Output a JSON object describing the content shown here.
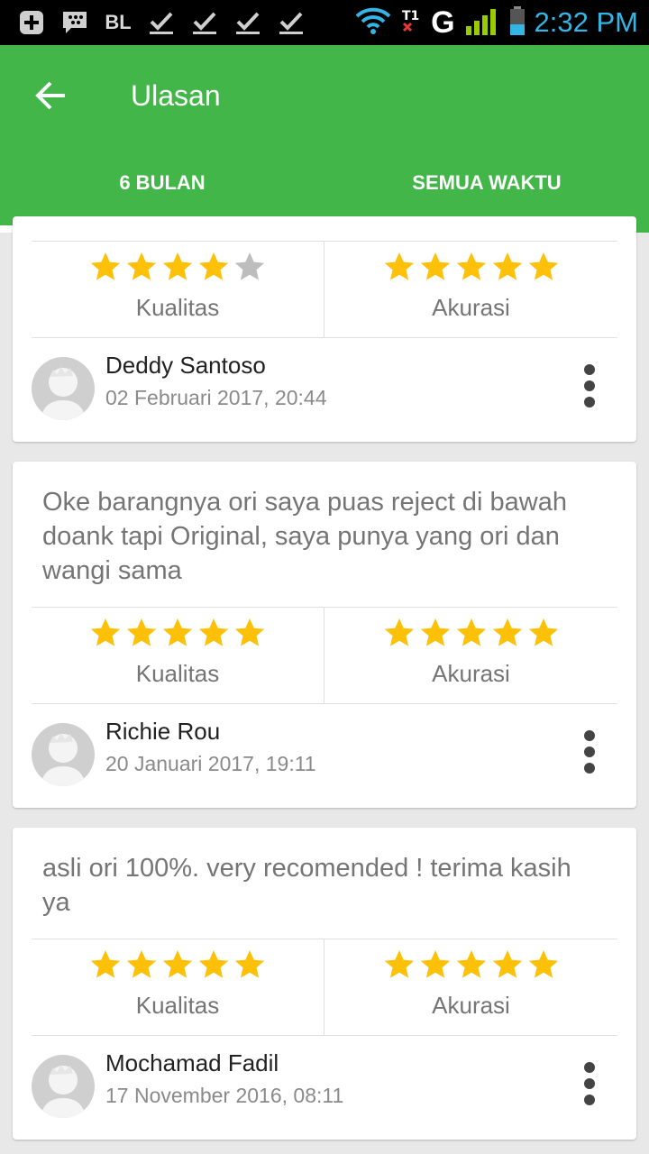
{
  "status_bar": {
    "left_icons": [
      "add-icon",
      "bbm-icon",
      "bl-text",
      "check-icon",
      "check-icon",
      "check-icon",
      "check-icon"
    ],
    "bl_text": "BL",
    "network_letter": "G",
    "time": "2:32 PM"
  },
  "app_bar": {
    "title": "Ulasan",
    "tabs": [
      {
        "label": "6 BULAN",
        "selected": true
      },
      {
        "label": "SEMUA WAKTU",
        "selected": false
      }
    ]
  },
  "colors": {
    "primary": "#43b649",
    "star_filled": "#ffc107",
    "star_empty": "#bdbdbd"
  },
  "reviews": [
    {
      "text": "",
      "quality_label": "Kualitas",
      "quality_stars": 4,
      "accuracy_label": "Akurasi",
      "accuracy_stars": 5,
      "name": "Deddy Santoso",
      "date": "02 Februari 2017, 20:44"
    },
    {
      "text": "Oke barangnya ori saya puas reject di bawah doank tapi Original, saya punya yang ori dan wangi sama",
      "quality_label": "Kualitas",
      "quality_stars": 5,
      "accuracy_label": "Akurasi",
      "accuracy_stars": 5,
      "name": "Richie Rou",
      "date": "20 Januari 2017, 19:11"
    },
    {
      "text": "asli ori 100%. very recomended ! terima kasih ya",
      "quality_label": "Kualitas",
      "quality_stars": 5,
      "accuracy_label": "Akurasi",
      "accuracy_stars": 5,
      "name": "Mochamad Fadil",
      "date": "17 November 2016, 08:11"
    }
  ]
}
